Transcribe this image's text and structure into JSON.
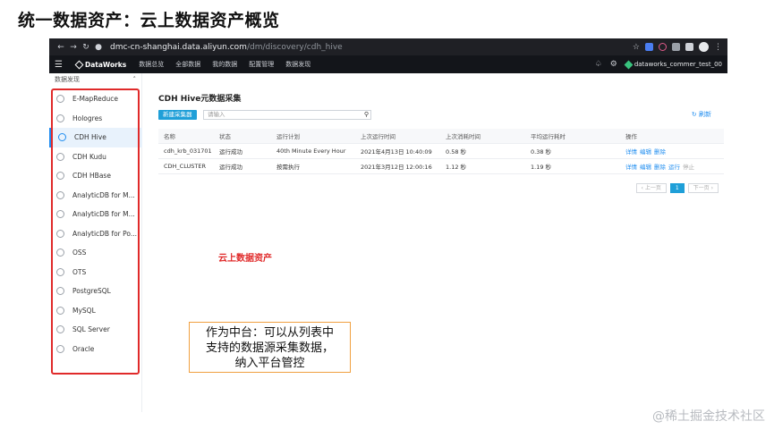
{
  "slide_title": "统一数据资产：云上数据资产概览",
  "browser": {
    "url_host": "dmc-cn-shanghai.data.aliyun.com",
    "url_path": "/dm/discovery/cdh_hive"
  },
  "app_bar": {
    "brand": "DataWorks",
    "menu": [
      "数据总览",
      "全部数据",
      "我的数据",
      "配置管理",
      "数据发现"
    ],
    "account": "dataworks_commer_test_00"
  },
  "sidebar": {
    "header": "数据发现",
    "items": [
      {
        "label": "E-MapReduce"
      },
      {
        "label": "Hologres"
      },
      {
        "label": "CDH Hive",
        "active": true
      },
      {
        "label": "CDH Kudu"
      },
      {
        "label": "CDH HBase"
      },
      {
        "label": "AnalyticDB for M..."
      },
      {
        "label": "AnalyticDB for M..."
      },
      {
        "label": "AnalyticDB for Po..."
      },
      {
        "label": "OSS"
      },
      {
        "label": "OTS"
      },
      {
        "label": "PostgreSQL"
      },
      {
        "label": "MySQL"
      },
      {
        "label": "SQL Server"
      },
      {
        "label": "Oracle"
      }
    ]
  },
  "main": {
    "title": "CDH Hive元数据采集",
    "new_button": "新建采集器",
    "search_placeholder": "请输入",
    "refresh": "刷新",
    "columns": [
      "名称",
      "状态",
      "运行计划",
      "上次运行时间",
      "上次消耗时间",
      "平均运行耗时",
      "操作"
    ],
    "rows": [
      {
        "name": "cdh_krb_031701",
        "status": "运行成功",
        "plan": "40th Minute Every Hour",
        "last_run": "2021年4月13日 10:40:09",
        "last_cost": "0.58 秒",
        "avg_cost": "0.38 秒",
        "ops": [
          "详情",
          "编辑",
          "删除"
        ]
      },
      {
        "name": "CDH_CLUSTER",
        "status": "运行成功",
        "plan": "按需执行",
        "last_run": "2021年3月12日 12:00:16",
        "last_cost": "1.12 秒",
        "avg_cost": "1.19 秒",
        "ops": [
          "详情",
          "编辑",
          "删除",
          "运行",
          "停止"
        ]
      }
    ],
    "pagination": {
      "prev": "上一页",
      "current": "1",
      "next": "下一页"
    }
  },
  "annotation_red": "云上数据资产",
  "note_lines": [
    "作为中台：可以从列表中",
    "支持的数据源采集数据，",
    "纳入平台管控"
  ],
  "watermark": "@稀土掘金技术社区",
  "colors": {
    "accent": "#1f9fd8",
    "highlight": "#e02a2a",
    "note_border": "#f0a040"
  }
}
